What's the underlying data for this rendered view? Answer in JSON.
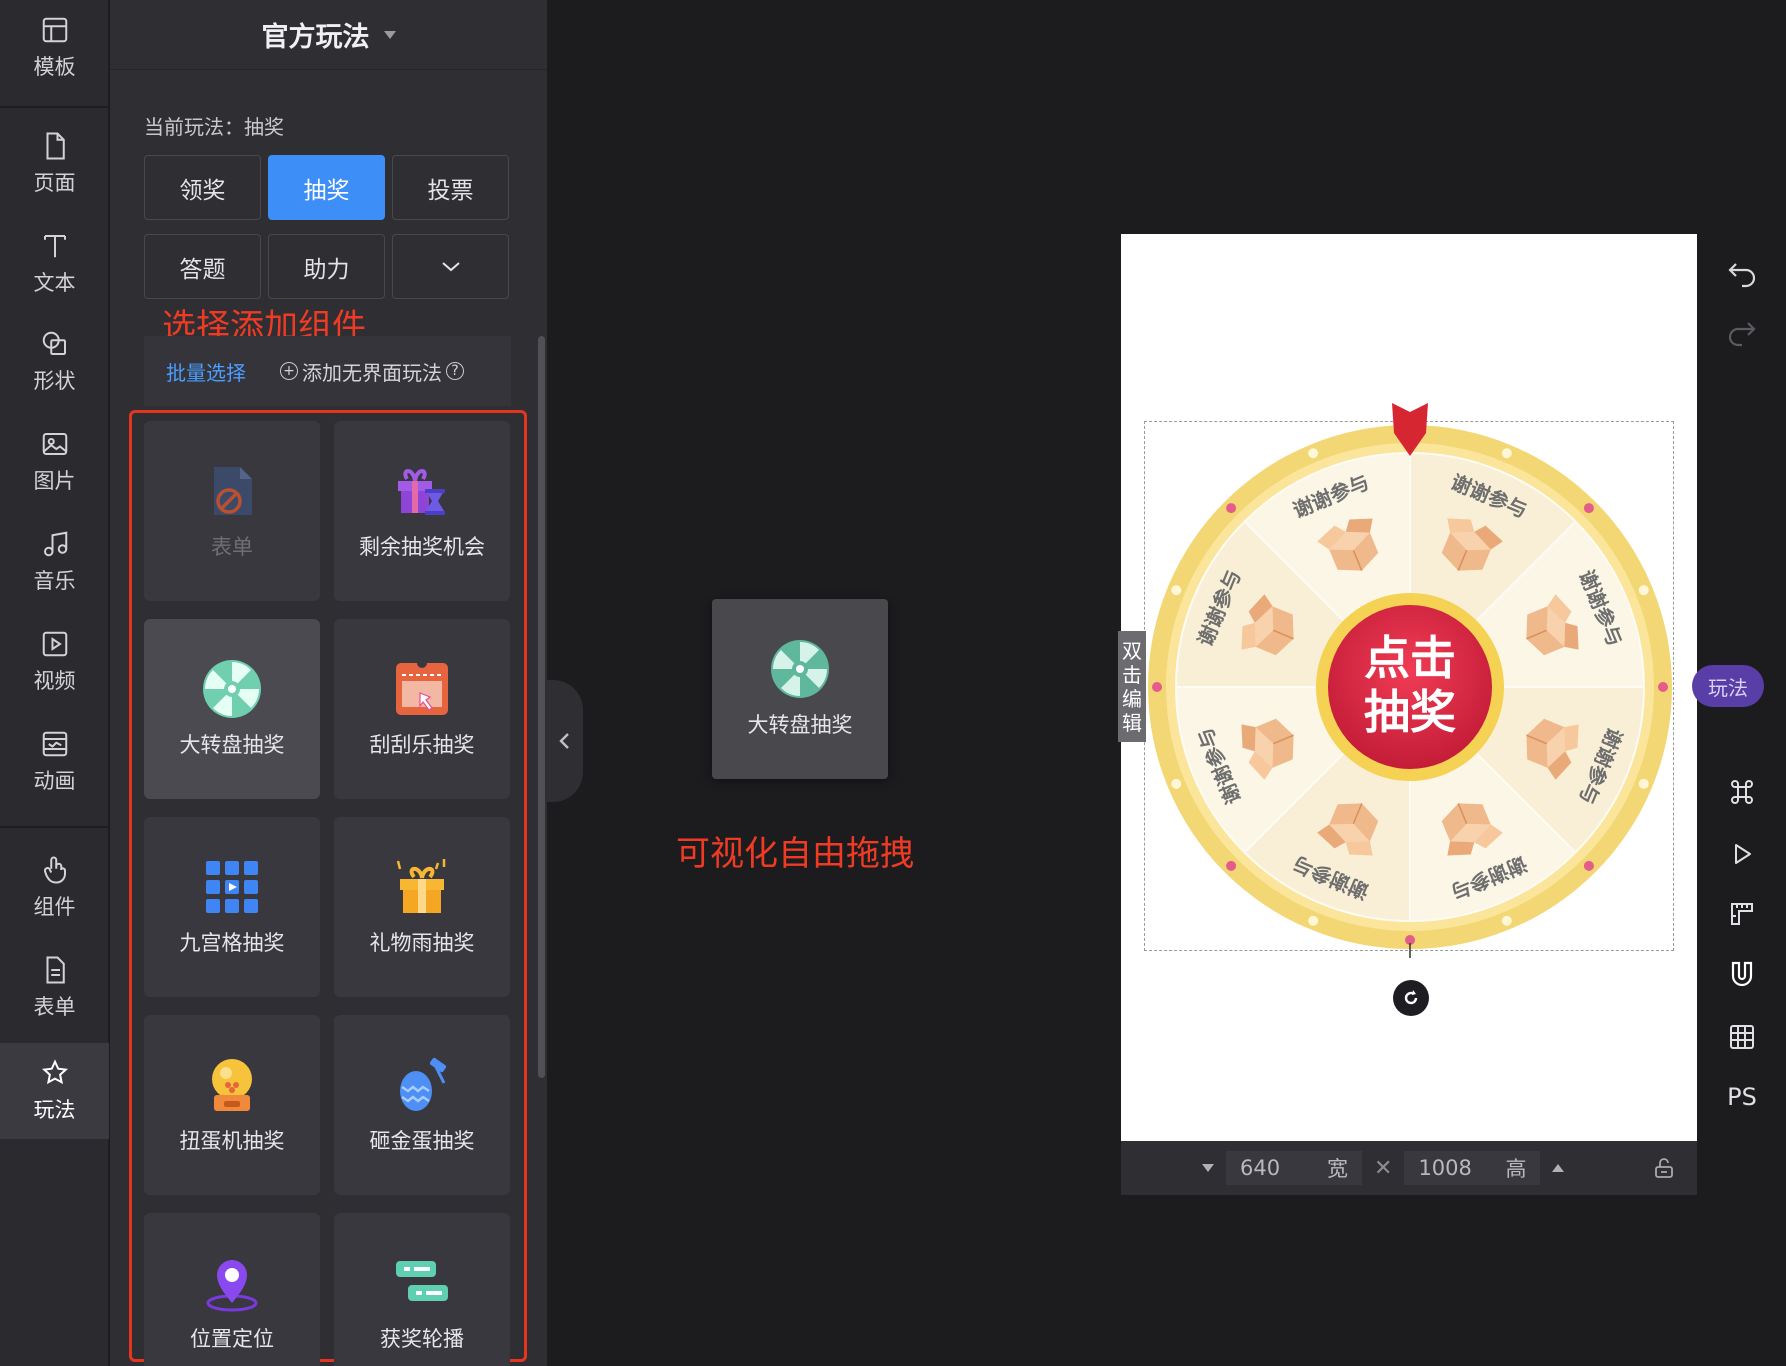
{
  "rail": {
    "items": [
      {
        "label": "模板",
        "icon": "template-icon"
      },
      {
        "label": "页面",
        "icon": "page-icon"
      },
      {
        "label": "文本",
        "icon": "text-icon"
      },
      {
        "label": "形状",
        "icon": "shape-icon"
      },
      {
        "label": "图片",
        "icon": "image-icon"
      },
      {
        "label": "音乐",
        "icon": "music-icon"
      },
      {
        "label": "视频",
        "icon": "video-icon"
      },
      {
        "label": "动画",
        "icon": "animation-icon"
      },
      {
        "label": "组件",
        "icon": "component-icon"
      },
      {
        "label": "表单",
        "icon": "form-icon"
      },
      {
        "label": "玩法",
        "icon": "gameplay-icon"
      }
    ],
    "active": "玩法"
  },
  "panel": {
    "title": "官方玩法",
    "current_label": "当前玩法：抽奖",
    "modes": [
      "领奖",
      "抽奖",
      "投票",
      "答题",
      "助力"
    ],
    "active_mode": "抽奖",
    "hint": "选择添加组件",
    "batch_select": "批量选择",
    "add_nonui": "添加无界面玩法",
    "components": [
      {
        "label": "表单",
        "icon": "form-disabled-icon",
        "disabled": true
      },
      {
        "label": "剩余抽奖机会",
        "icon": "gift-hourglass-icon"
      },
      {
        "label": "大转盘抽奖",
        "icon": "wheel-icon",
        "highlighted": true
      },
      {
        "label": "刮刮乐抽奖",
        "icon": "scratch-card-icon"
      },
      {
        "label": "九宫格抽奖",
        "icon": "grid-icon"
      },
      {
        "label": "礼物雨抽奖",
        "icon": "gift-rain-icon"
      },
      {
        "label": "扭蛋机抽奖",
        "icon": "gashapon-icon"
      },
      {
        "label": "砸金蛋抽奖",
        "icon": "golden-egg-icon"
      },
      {
        "label": "位置定位",
        "icon": "location-icon"
      },
      {
        "label": "获奖轮播",
        "icon": "carousel-icon"
      }
    ]
  },
  "drag": {
    "label": "大转盘抽奖",
    "hint": "可视化自由拖拽"
  },
  "canvas": {
    "double_click": [
      "双",
      "击",
      "编",
      "辑"
    ],
    "wheel_center": [
      "点击",
      "抽奖"
    ],
    "segment_label": "谢谢参与",
    "width_value": "640",
    "width_unit": "宽",
    "height_value": "1008",
    "height_unit": "高"
  },
  "right_rail": {
    "pill": "玩法",
    "ps": "PS"
  },
  "colors": {
    "accent": "#3d8ff7",
    "highlight_red": "#e6351f",
    "wheel_rim": "#f3d774",
    "wheel_center": "#d6263f"
  }
}
